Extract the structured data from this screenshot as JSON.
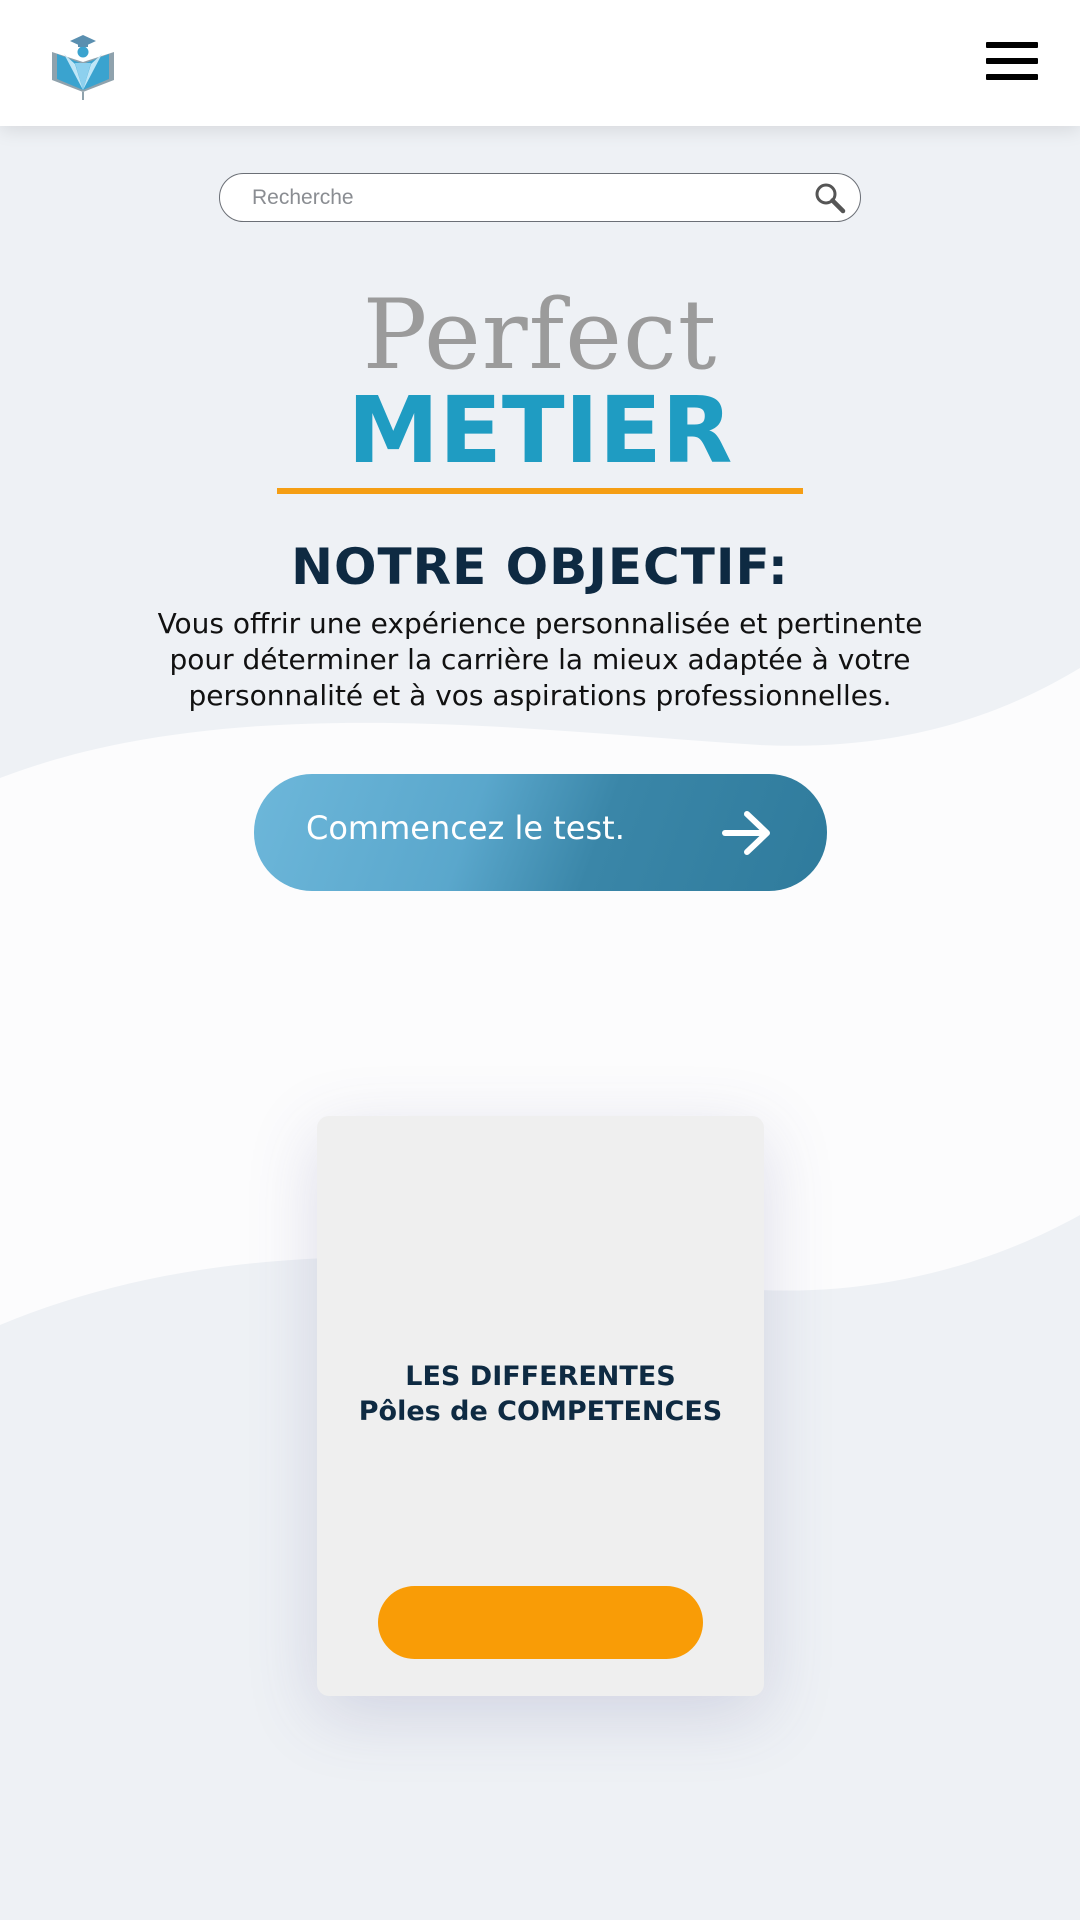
{
  "header": {
    "logo_icon": "graduation-book-logo-icon",
    "menu_icon": "hamburger-menu-icon"
  },
  "search": {
    "placeholder": "Recherche",
    "icon": "search-icon"
  },
  "brand": {
    "perfect": "Perfect",
    "metier": "METIER"
  },
  "objective": {
    "title": "NOTRE OBJECTIF:",
    "line1": "Vous offrir une expérience personnalisée et pertinente",
    "line2": "pour déterminer la carrière la mieux adaptée à votre",
    "line3": "personnalité et à vos aspirations professionnelles."
  },
  "cta": {
    "label": "Commencez le test.",
    "icon": "arrow-right-icon"
  },
  "card": {
    "title_line1": "LES DIFFERENTES",
    "title_line2": "Pôles de COMPETENCES",
    "button_label": ""
  },
  "colors": {
    "accent_blue": "#1f9cc2",
    "accent_orange": "#f99c06",
    "dark_navy": "#0e2a42",
    "brand_gray": "#9b9b9b",
    "background": "#eef1f5"
  }
}
